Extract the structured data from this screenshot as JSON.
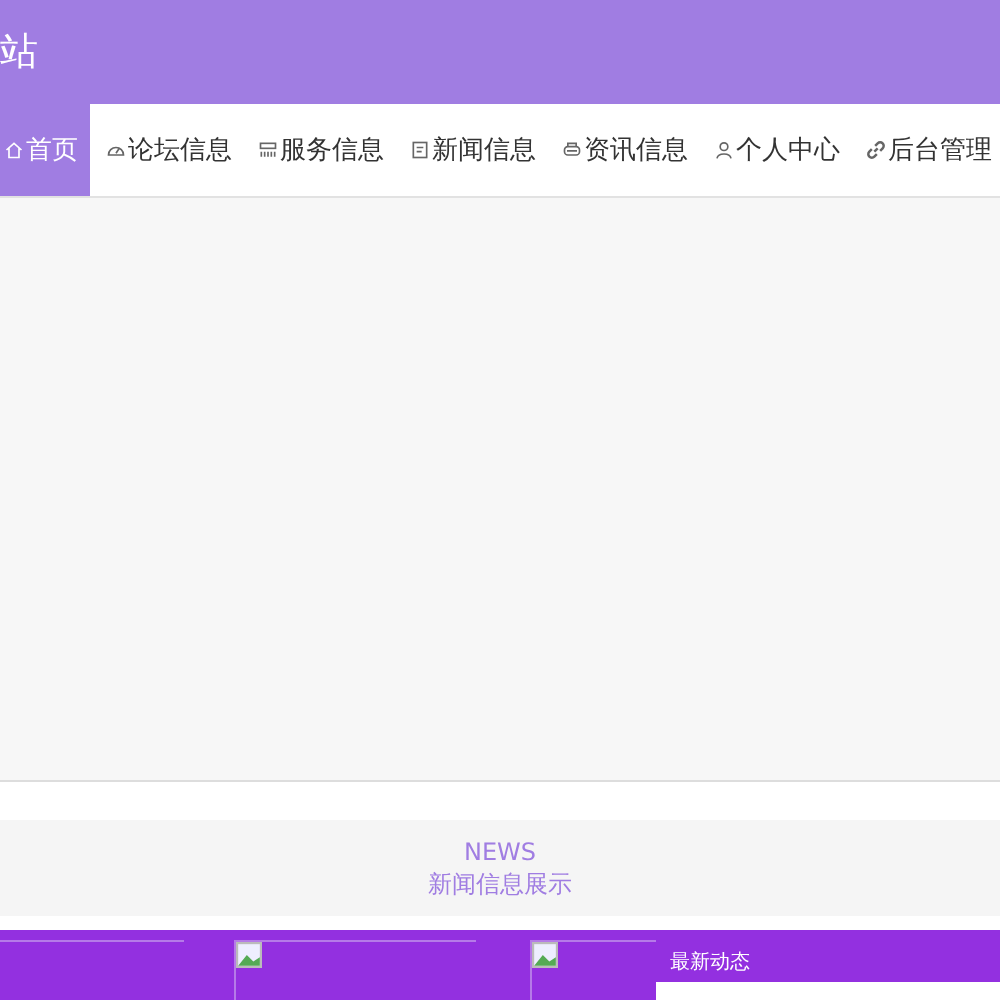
{
  "header": {
    "title": "站"
  },
  "nav": [
    {
      "label": "首页",
      "kind": "home",
      "selected": true
    },
    {
      "label": "论坛信息",
      "kind": "gauge",
      "selected": false
    },
    {
      "label": "服务信息",
      "kind": "grid",
      "selected": false
    },
    {
      "label": "新闻信息",
      "kind": "doc",
      "selected": false
    },
    {
      "label": "资讯信息",
      "kind": "printer",
      "selected": false
    },
    {
      "label": "个人中心",
      "kind": "user",
      "selected": false
    },
    {
      "label": "后台管理",
      "kind": "link",
      "selected": false
    }
  ],
  "news": {
    "eyebrow": "NEWS",
    "title": "新闻信息展示",
    "latest_title": "最新动态"
  }
}
